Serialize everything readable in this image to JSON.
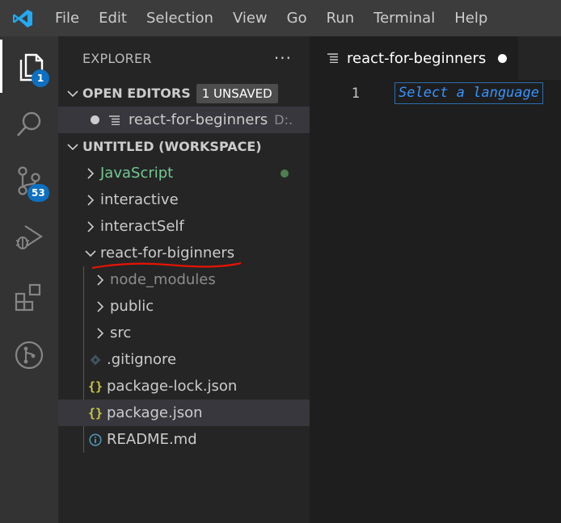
{
  "menu": [
    "File",
    "Edit",
    "Selection",
    "View",
    "Go",
    "Run",
    "Terminal",
    "Help"
  ],
  "activity": {
    "explorer_badge": "1",
    "source_control_badge": "53"
  },
  "sidebar": {
    "title": "EXPLORER",
    "more": "···",
    "open_editors": {
      "label": "OPEN EDITORS",
      "badge": "1 UNSAVED",
      "items": [
        {
          "name": "react-for-beginners",
          "desc": "D:."
        }
      ]
    },
    "workspace": {
      "label": "UNTITLED (WORKSPACE)",
      "folders": [
        {
          "name": "JavaScript"
        },
        {
          "name": "interactive"
        },
        {
          "name": "interactSelf"
        },
        {
          "name": "react-for-biginners"
        }
      ],
      "children": [
        {
          "name": "node_modules"
        },
        {
          "name": "public"
        },
        {
          "name": "src"
        },
        {
          "name": ".gitignore"
        },
        {
          "name": "package-lock.json"
        },
        {
          "name": "package.json"
        },
        {
          "name": "README.md"
        }
      ]
    }
  },
  "editor": {
    "tab_title": "react-for-beginners",
    "line_number": "1",
    "hint": "Select a language"
  },
  "colors": {
    "accent": "#0e70c0",
    "git_untracked": "#73c991",
    "json_icon": "#cbcb41",
    "annotation": "#e51400"
  }
}
